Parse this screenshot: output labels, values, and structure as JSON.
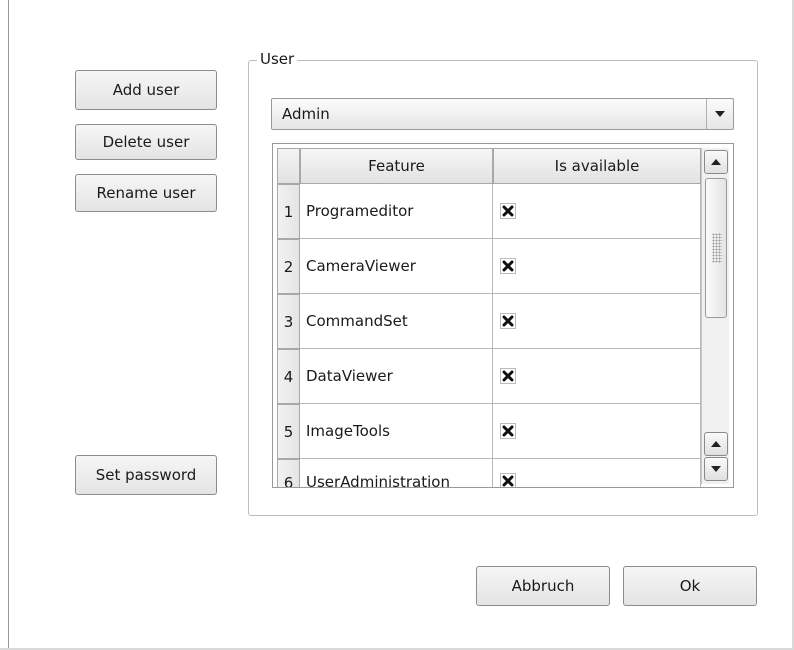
{
  "left_buttons": {
    "add_user": "Add user",
    "delete_user": "Delete user",
    "rename_user": "Rename user",
    "set_password": "Set password"
  },
  "group": {
    "title": "User",
    "selected_user": "Admin"
  },
  "table": {
    "columns": [
      "Feature",
      "Is available"
    ],
    "rows": [
      {
        "index": "1",
        "feature": "Programeditor",
        "available": true
      },
      {
        "index": "2",
        "feature": "CameraViewer",
        "available": true
      },
      {
        "index": "3",
        "feature": "CommandSet",
        "available": true
      },
      {
        "index": "4",
        "feature": "DataViewer",
        "available": true
      },
      {
        "index": "5",
        "feature": "ImageTools",
        "available": true
      },
      {
        "index": "6",
        "feature": "UserAdministration",
        "available": true
      }
    ]
  },
  "icons": {
    "available_mark": "x-mark-icon",
    "dropdown": "chevron-down-icon",
    "scroll_up": "arrow-up-icon",
    "scroll_down": "arrow-down-icon"
  },
  "footer": {
    "cancel": "Abbruch",
    "ok": "Ok"
  }
}
